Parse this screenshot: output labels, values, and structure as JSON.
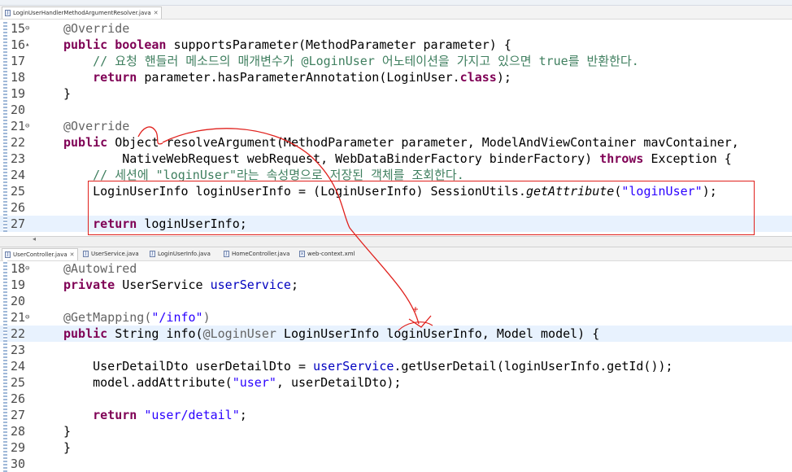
{
  "top_editor": {
    "tab": {
      "label": "LoginUserHandlerMethodArgumentResolver.java",
      "close": "✕"
    },
    "lines": [
      {
        "num": "15",
        "fold": "⊖",
        "tokens": [
          {
            "t": "@Override",
            "c": "an"
          }
        ]
      },
      {
        "num": "16",
        "fold": "▴",
        "tokens": [
          {
            "t": "public boolean ",
            "c": "kw"
          },
          {
            "t": "supportsParameter(MethodParameter parameter) {",
            "c": ""
          }
        ]
      },
      {
        "num": "17",
        "tokens": [
          {
            "t": "    // 요청 핸들러 메소드의 매개변수가 ",
            "c": "cm"
          },
          {
            "t": "@LoginUser",
            "c": "cm"
          },
          {
            "t": " 어노테이션을 가지고 있으면 ",
            "c": "cm"
          },
          {
            "t": "true",
            "c": "cm"
          },
          {
            "t": "를 반환한다.",
            "c": "cm"
          }
        ]
      },
      {
        "num": "18",
        "tokens": [
          {
            "t": "    ",
            "c": ""
          },
          {
            "t": "return ",
            "c": "kw"
          },
          {
            "t": "parameter.hasParameterAnnotation(LoginUser.",
            "c": ""
          },
          {
            "t": "class",
            "c": "kw"
          },
          {
            "t": ");",
            "c": ""
          }
        ]
      },
      {
        "num": "19",
        "tokens": [
          {
            "t": "}",
            "c": ""
          }
        ]
      },
      {
        "num": "20",
        "tokens": []
      },
      {
        "num": "21",
        "fold": "⊖",
        "tokens": [
          {
            "t": "@Override",
            "c": "an"
          }
        ]
      },
      {
        "num": "22",
        "tokens": [
          {
            "t": "public ",
            "c": "kw"
          },
          {
            "t": "Object resolveArgument(MethodParameter parameter, ModelAndViewContainer mavContainer,",
            "c": ""
          }
        ]
      },
      {
        "num": "23",
        "tokens": [
          {
            "t": "        NativeWebRequest webRequest, WebDataBinderFactory binderFactory) ",
            "c": ""
          },
          {
            "t": "throws ",
            "c": "kw"
          },
          {
            "t": "Exception {",
            "c": ""
          }
        ]
      },
      {
        "num": "24",
        "tokens": [
          {
            "t": "    // 세션에 \"loginUser\"라는 속성명으로 저장된 객체를 조회한다.",
            "c": "cm"
          }
        ]
      },
      {
        "num": "25",
        "tokens": [
          {
            "t": "    LoginUserInfo loginUserInfo = (LoginUserInfo) SessionUtils.",
            "c": ""
          },
          {
            "t": "getAttribute",
            "c": "it"
          },
          {
            "t": "(",
            "c": ""
          },
          {
            "t": "\"loginUser\"",
            "c": "st"
          },
          {
            "t": ");",
            "c": ""
          }
        ]
      },
      {
        "num": "26",
        "tokens": []
      },
      {
        "num": "27",
        "highlight": true,
        "tokens": [
          {
            "t": "    ",
            "c": ""
          },
          {
            "t": "return ",
            "c": "kw"
          },
          {
            "t": "loginUserInfo;",
            "c": ""
          }
        ]
      }
    ]
  },
  "bottom_editor": {
    "tabs": [
      {
        "label": "UserController.java",
        "close": "✕",
        "active": true
      },
      {
        "label": "UserService.java"
      },
      {
        "label": "LoginUserInfo.java"
      },
      {
        "label": "HomeController.java"
      },
      {
        "label": "web-context.xml"
      }
    ],
    "lines": [
      {
        "num": "18",
        "fold": "⊖",
        "tokens": [
          {
            "t": "@Autowired",
            "c": "an"
          }
        ]
      },
      {
        "num": "19",
        "tokens": [
          {
            "t": "private ",
            "c": "kw"
          },
          {
            "t": "UserService ",
            "c": ""
          },
          {
            "t": "userService",
            "c": "fd"
          },
          {
            "t": ";",
            "c": ""
          }
        ]
      },
      {
        "num": "20",
        "tokens": []
      },
      {
        "num": "21",
        "fold": "⊖",
        "tokens": [
          {
            "t": "@GetMapping(",
            "c": "an"
          },
          {
            "t": "\"/info\"",
            "c": "st"
          },
          {
            "t": ")",
            "c": "an"
          }
        ]
      },
      {
        "num": "22",
        "highlight": true,
        "tokens": [
          {
            "t": "public ",
            "c": "kw"
          },
          {
            "t": "String info(",
            "c": ""
          },
          {
            "t": "@LoginUser",
            "c": "an"
          },
          {
            "t": " LoginUserInfo loginUserInfo, Model model) {",
            "c": ""
          }
        ]
      },
      {
        "num": "23",
        "tokens": []
      },
      {
        "num": "24",
        "tokens": [
          {
            "t": "    UserDetailDto userDetailDto = ",
            "c": ""
          },
          {
            "t": "userService",
            "c": "fd"
          },
          {
            "t": ".getUserDetail(loginUserInfo.getId());",
            "c": ""
          }
        ]
      },
      {
        "num": "25",
        "tokens": [
          {
            "t": "    model.addAttribute(",
            "c": ""
          },
          {
            "t": "\"user\"",
            "c": "st"
          },
          {
            "t": ", userDetailDto);",
            "c": ""
          }
        ]
      },
      {
        "num": "26",
        "tokens": []
      },
      {
        "num": "27",
        "tokens": [
          {
            "t": "    ",
            "c": ""
          },
          {
            "t": "return ",
            "c": "kw"
          },
          {
            "t": "\"user/detail\"",
            "c": "st"
          },
          {
            "t": ";",
            "c": ""
          }
        ]
      },
      {
        "num": "28",
        "tokens": [
          {
            "t": "}",
            "c": ""
          }
        ]
      },
      {
        "num": "29",
        "tokens": [
          {
            "t": "}",
            "c": ""
          }
        ]
      },
      {
        "num": "30",
        "tokens": []
      }
    ]
  },
  "colors": {
    "annotation_red": "#e0201c",
    "current_line": "#e8f2fe",
    "keyword": "#7f0055",
    "comment": "#3f7f5f",
    "string": "#2a00ff"
  }
}
